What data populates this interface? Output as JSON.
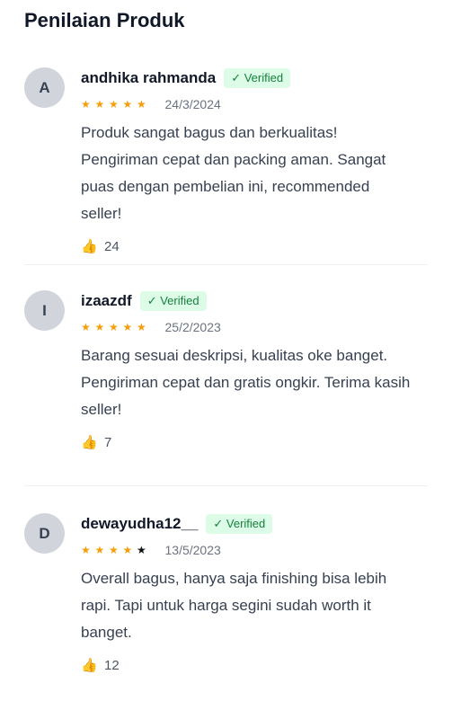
{
  "title": "Penilaian Produk",
  "reviews": [
    {
      "avatar": "A",
      "name": "andhika rahmanda",
      "badge": "✓ Verified",
      "rating": 5,
      "date": "24/3/2024",
      "text": "Produk sangat bagus dan berkualitas! Pengiriman cepat dan packing aman. Sangat puas dengan pembelian ini, recommended seller!",
      "likes": "24"
    },
    {
      "avatar": "I",
      "name": "izaazdf",
      "badge": "✓ Verified",
      "rating": 5,
      "date": "25/2/2023",
      "text": "Barang sesuai deskripsi, kualitas oke banget. Pengiriman cepat dan gratis ongkir. Terima kasih seller!",
      "likes": "7"
    },
    {
      "avatar": "D",
      "name": "dewayudha12__",
      "badge": "✓ Verified",
      "rating": 4,
      "date": "13/5/2023",
      "text": "Overall bagus, hanya saja finishing bisa lebih rapi. Tapi untuk harga segini sudah worth it banget.",
      "likes": "12"
    }
  ],
  "icons": {
    "star": "star-icon",
    "like": "thumbs-up-icon"
  },
  "colors": {
    "star_on": "#f59e0b",
    "star_off": "#111111",
    "verified_bg": "#dcfce7",
    "verified_text": "#16803d",
    "avatar_bg": "#d1d5db"
  }
}
